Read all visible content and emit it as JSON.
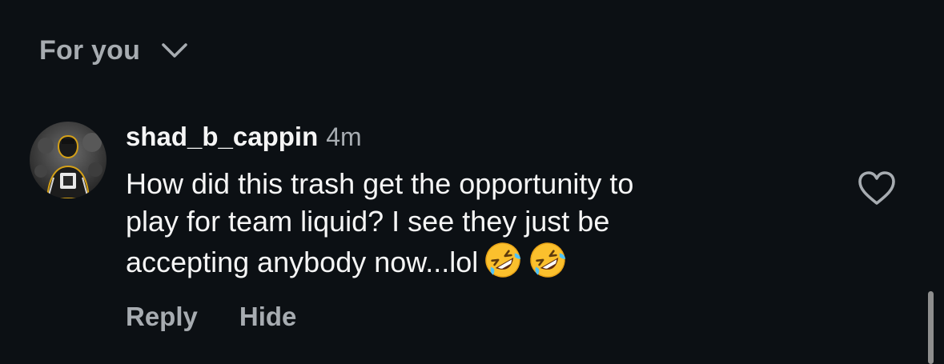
{
  "sort": {
    "label": "For you",
    "icon": "chevron-down-icon"
  },
  "comment": {
    "avatar_icon": "user-avatar",
    "username": "shad_b_cappin",
    "timestamp": "4m",
    "text_lines": [
      "How did this trash get the opportunity to",
      "play for team liquid? I see they just be",
      "accepting anybody now...lol"
    ],
    "emoji": [
      "🤣",
      "🤣"
    ],
    "like_icon": "heart-outline-icon"
  },
  "actions": {
    "reply_label": "Reply",
    "hide_label": "Hide"
  },
  "colors": {
    "background": "#0c1014",
    "primary_text": "#f5f5f5",
    "secondary_text": "#a7acb1",
    "scrollbar": "#8e8e8e"
  }
}
